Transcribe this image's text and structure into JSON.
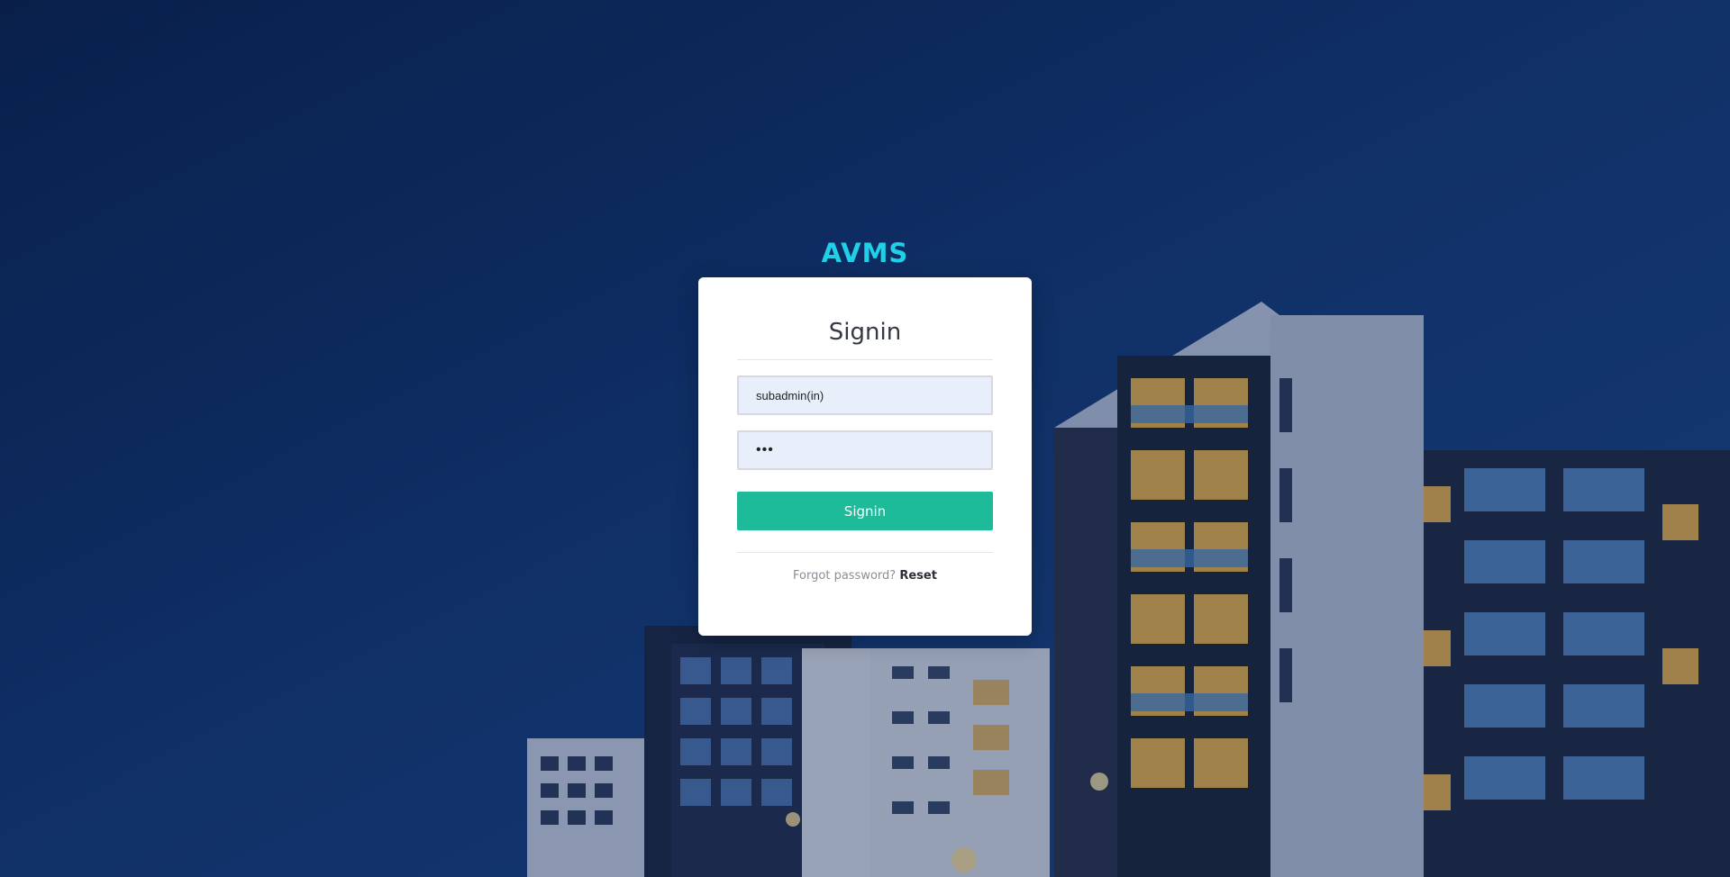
{
  "brand": {
    "logo_text": "AVMS"
  },
  "login": {
    "title": "Signin",
    "username_value": "subadmin(in)",
    "password_value": "•••",
    "submit_label": "Signin",
    "forgot_text": "Forgot password?",
    "reset_link": "Reset"
  },
  "colors": {
    "accent": "#1fd0e6",
    "button": "#1dbb99",
    "background": "#11306a"
  }
}
